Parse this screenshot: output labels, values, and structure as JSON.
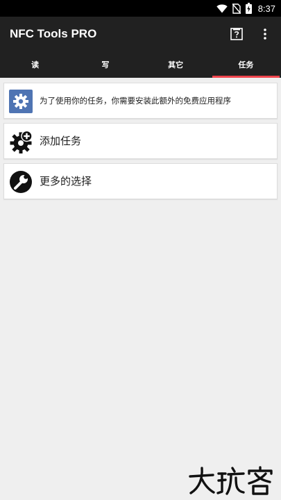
{
  "status_bar": {
    "time": "8:37",
    "icons": [
      "wifi-icon",
      "no-sim-icon",
      "battery-icon"
    ]
  },
  "app_bar": {
    "title": "NFC Tools PRO",
    "actions": [
      "help-icon",
      "overflow-menu-icon"
    ]
  },
  "tabs": [
    {
      "label": "读",
      "active": false
    },
    {
      "label": "写",
      "active": false
    },
    {
      "label": "其它",
      "active": false
    },
    {
      "label": "任务",
      "active": true
    }
  ],
  "cards": {
    "info": {
      "text": "为了使用你的任务，你需要安装此额外的免费应用程序",
      "icon": "gear-icon"
    },
    "add_task": {
      "text": "添加任务",
      "icon": "add-gear-icon"
    },
    "more_options": {
      "text": "更多的选择",
      "icon": "wrench-icon"
    }
  },
  "watermark": {
    "text": "大玩客"
  },
  "colors": {
    "status_bar": "#000000",
    "app_bar": "#212121",
    "tab_indicator": "#f0454d",
    "background": "#efefef",
    "info_icon_bg": "#4f74b3"
  }
}
